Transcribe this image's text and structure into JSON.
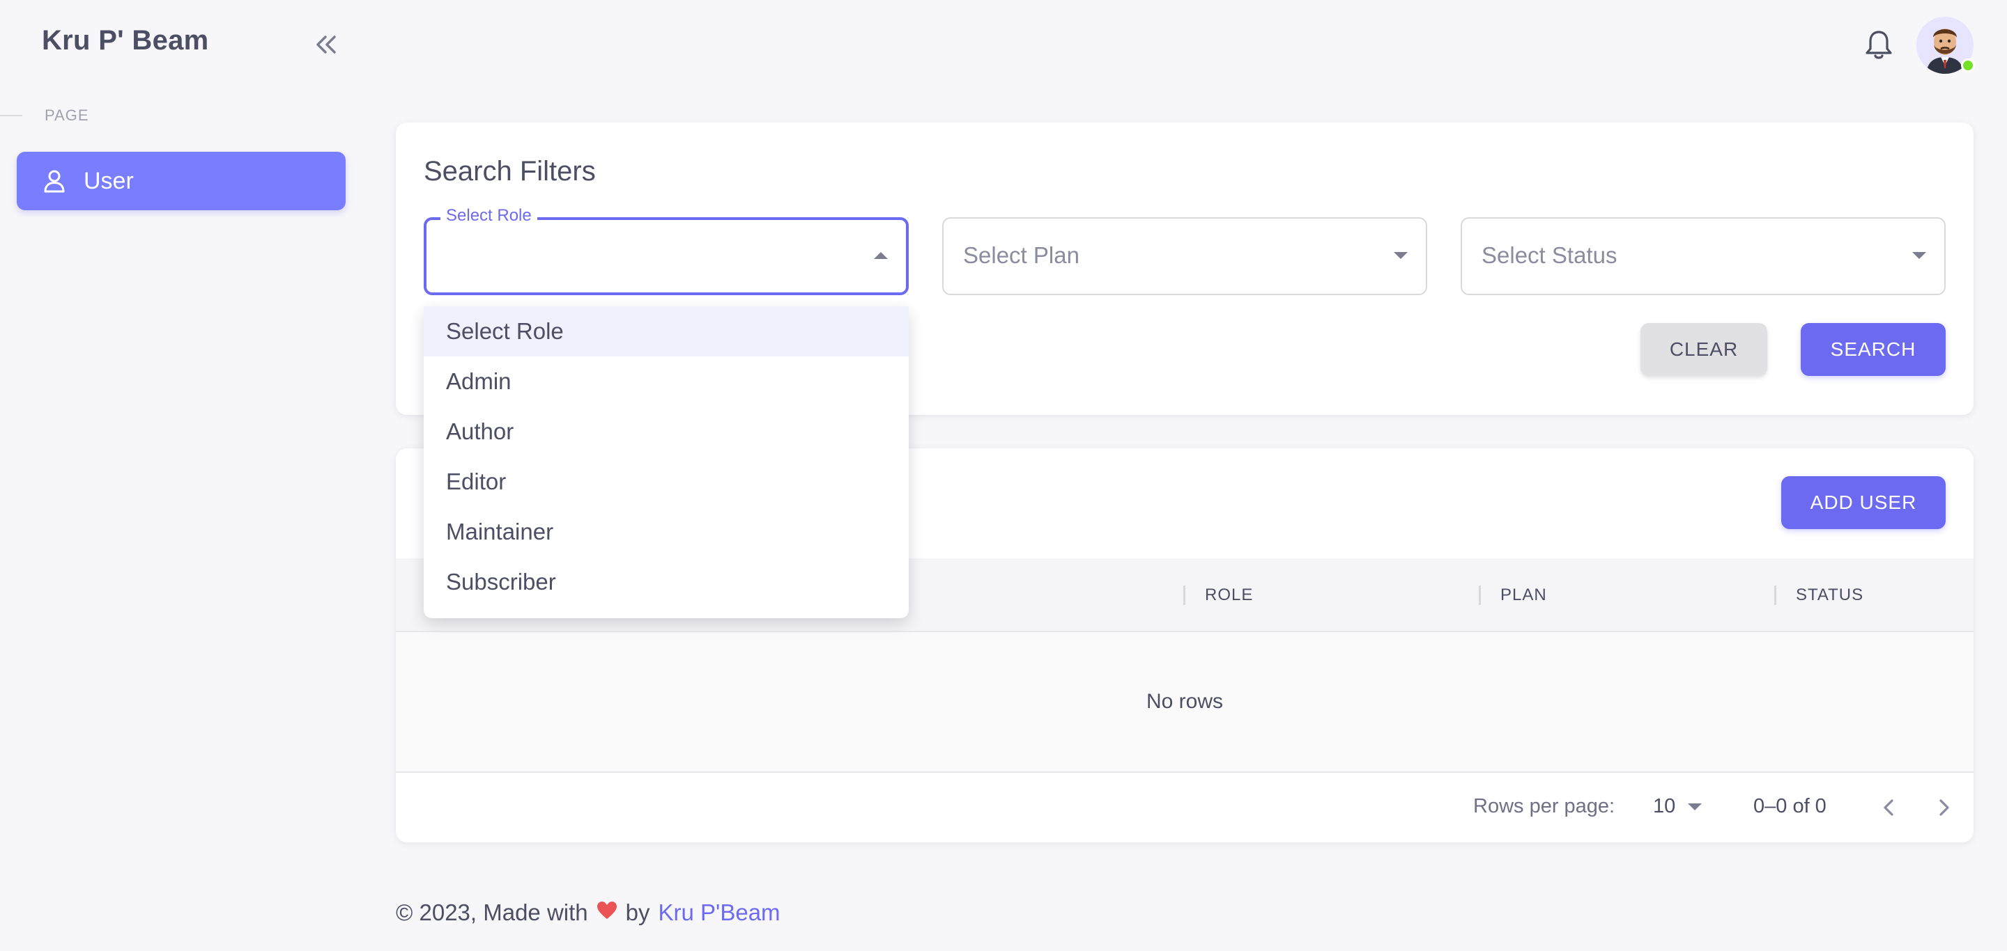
{
  "sidebar": {
    "brand": "Kru P' Beam",
    "section_label": "PAGE",
    "items": [
      {
        "label": "User",
        "icon": "user-icon",
        "active": true
      }
    ]
  },
  "topbar": {
    "notification_icon": "bell-icon",
    "avatar_status": "online"
  },
  "filters": {
    "title": "Search Filters",
    "role": {
      "label": "Select Role",
      "value": ""
    },
    "plan": {
      "placeholder": "Select Plan"
    },
    "status": {
      "placeholder": "Select Status"
    },
    "clear_label": "CLEAR",
    "search_label": "SEARCH"
  },
  "role_dropdown": {
    "options": [
      "Select Role",
      "Admin",
      "Author",
      "Editor",
      "Maintainer",
      "Subscriber"
    ],
    "highlighted": "Select Role"
  },
  "users": {
    "add_label": "ADD USER",
    "columns": [
      "ROLE",
      "PLAN",
      "STATUS"
    ],
    "empty_text": "No rows",
    "rows_per_page_label": "Rows per page:",
    "rows_per_page": "10",
    "page_range": "0–0 of 0"
  },
  "footer": {
    "prefix": "© 2023, Made with",
    "by": "by",
    "link": "Kru P'Beam"
  },
  "colors": {
    "primary": "#6d6af2",
    "nav_active": "#787eff",
    "heart": "#ea5455",
    "online": "#72e128"
  }
}
